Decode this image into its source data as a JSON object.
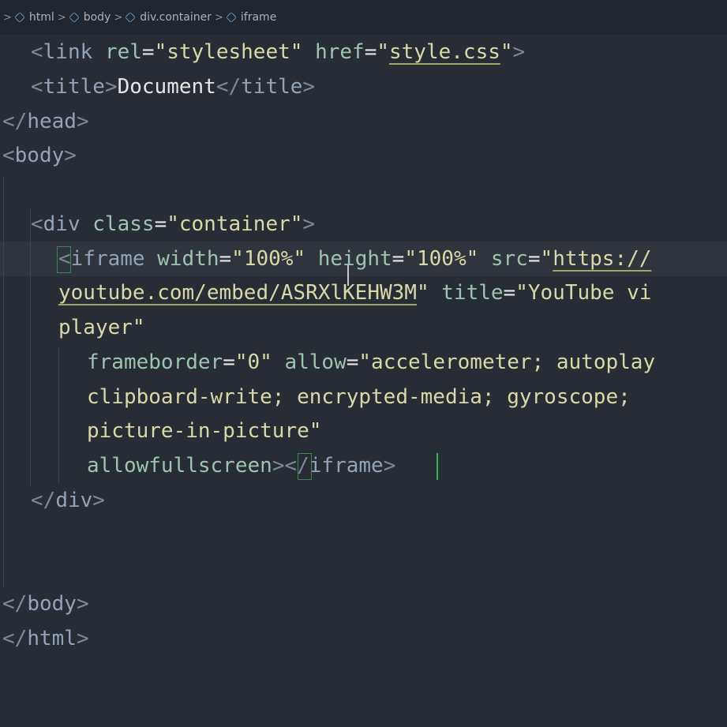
{
  "breadcrumb": {
    "lead_sep": ">",
    "items": [
      {
        "label": "html",
        "icon": "cube-icon"
      },
      {
        "label": "body",
        "icon": "cube-icon"
      },
      {
        "label": "div.container",
        "icon": "cube-icon"
      },
      {
        "label": "iframe",
        "icon": "cube-icon"
      }
    ]
  },
  "colors": {
    "background": "#282c34",
    "tag": "#94a3b8",
    "attribute": "#9cc5b0",
    "string": "#d9d8a8",
    "bracket_match": "#3c8a4a"
  },
  "code": {
    "line1": {
      "open": "<",
      "tag": "link",
      "attr1": "rel",
      "eq1": "=",
      "val1": "\"stylesheet\"",
      "attr2": "href",
      "eq2": "=",
      "q_open": "\"",
      "url": "style.css",
      "q_close": "\"",
      "close": ">"
    },
    "line2": {
      "open": "<",
      "tag": "title",
      "close": ">",
      "text": "Document",
      "end_open": "</",
      "end_tag": "title",
      "end_close": ">"
    },
    "line3": {
      "open": "</",
      "tag": "head",
      "close": ">"
    },
    "line4": {
      "open": "<",
      "tag": "body",
      "close": ">"
    },
    "line6": {
      "open": "<",
      "tag": "div",
      "attr": "class",
      "eq": "=",
      "val": "\"container\"",
      "close": ">"
    },
    "line7": {
      "open": "<",
      "tag": "iframe",
      "attr1": "width",
      "eq1": "=",
      "val1": "\"100%\"",
      "attr2": "height",
      "eq2": "=",
      "val2": "\"100%\"",
      "attr3": "src",
      "eq3": "=",
      "q_open": "\"",
      "url": "https://"
    },
    "line8": {
      "url": "youtube.com/embed/ASRXlKEHW3M",
      "q_close": "\"",
      "attr": "title",
      "eq": "=",
      "val": "\"YouTube vi"
    },
    "line9": {
      "val": "player\""
    },
    "line10": {
      "attr": "frameborder",
      "eq": "=",
      "val": "\"0\"",
      "attr2": "allow",
      "eq2": "=",
      "val2": "\"accelerometer; autoplay"
    },
    "line11": {
      "val": "clipboard-write; encrypted-media; gyroscope;"
    },
    "line12": {
      "val": "picture-in-picture\""
    },
    "line13": {
      "attr": "allowfullscreen",
      "close": ">",
      "end_open": "</",
      "end_tag": "iframe",
      "end_close": ">"
    },
    "line14": {
      "open": "</",
      "tag": "div",
      "close": ">"
    },
    "line17": {
      "open": "</",
      "tag": "body",
      "close": ">"
    },
    "line18": {
      "open": "</",
      "tag": "html",
      "close": ">"
    }
  }
}
